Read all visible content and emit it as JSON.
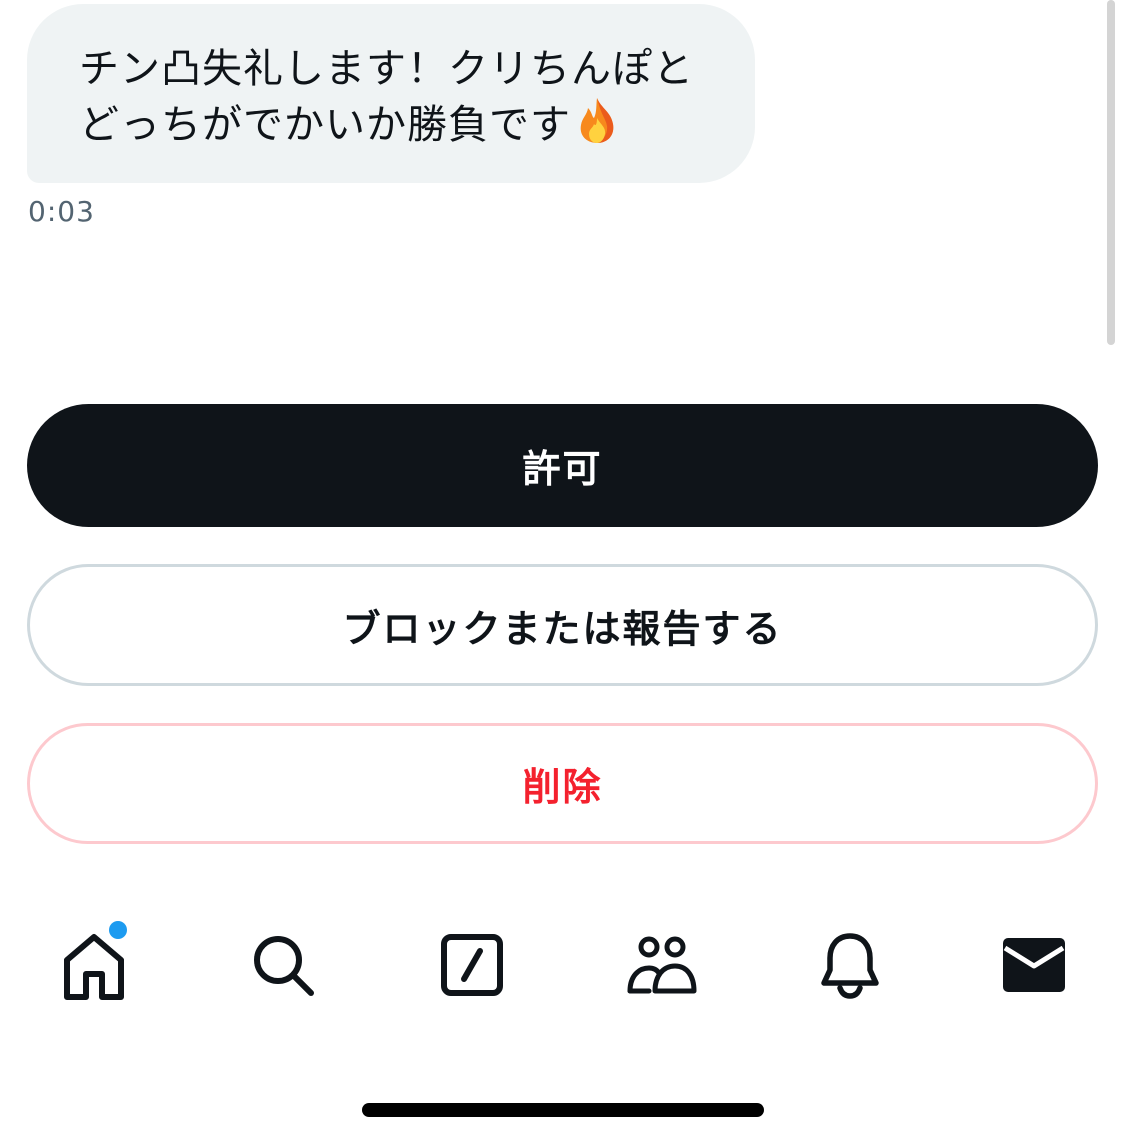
{
  "message": {
    "text": "チン凸失礼します！クリちんぽと\nどっちがでかいか勝負です",
    "emoji": "fire-emoji",
    "timestamp": "0:03"
  },
  "actions": {
    "allow_label": "許可",
    "block_report_label": "ブロックまたは報告する",
    "delete_label": "削除"
  },
  "tabbar": {
    "icons": [
      "home-icon",
      "search-icon",
      "compose-icon",
      "communities-icon",
      "notifications-icon",
      "messages-icon"
    ],
    "home_has_unread_dot": true
  },
  "colors": {
    "primary_button": "#0f1419",
    "bubble_bg": "#eff3f4",
    "delete_red": "#f4212e",
    "delete_border": "#fdc9ce",
    "neutral_border": "#cfd9de",
    "unread_dot": "#1d9bf0",
    "timestamp_gray": "#536471"
  }
}
